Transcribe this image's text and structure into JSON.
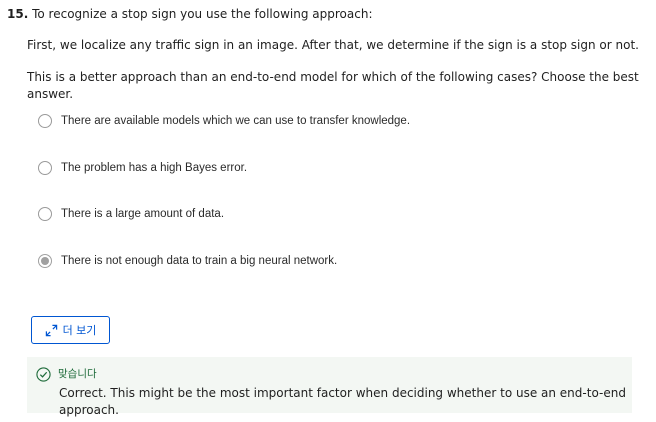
{
  "question": {
    "number": "15.",
    "title": "To recognize a stop sign you use the following approach:",
    "paragraph1": "First, we localize any traffic sign in an image. After that, we determine if the sign is a stop sign or not.",
    "paragraph2": "This is a better approach than an end-to-end model for which of the following cases? Choose the best answer."
  },
  "options": [
    {
      "label": "There are available models which we can use to transfer knowledge.",
      "selected": false
    },
    {
      "label": "The problem has a high Bayes error.",
      "selected": false
    },
    {
      "label": "There is a large amount of data.",
      "selected": false
    },
    {
      "label": "There is not enough data to train a big neural network.",
      "selected": true
    }
  ],
  "more_button": {
    "label": "더 보기",
    "icon": "expand-arrows-icon"
  },
  "feedback": {
    "status": "맞습니다",
    "icon": "check-circle-icon",
    "text": "Correct. This might be the most important factor when deciding whether to use an end-to-end approach.",
    "color": "#1e6b3a"
  },
  "colors": {
    "accent": "#0056d2",
    "feedback_bg": "#f3f7f3"
  }
}
